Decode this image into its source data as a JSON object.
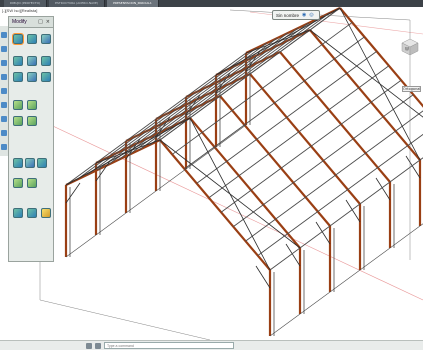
{
  "tabs": [
    "DIBUJO (PROYECTO)",
    "ESTRUCTURA (ACERO-NAVE)",
    "PRESENTACION_PARCIAL1"
  ],
  "active_tab_index": 2,
  "viewport": {
    "label": "[-][SW Iso][Realista]"
  },
  "modify_palette": {
    "title": "Modify",
    "pin": "□",
    "close": "×"
  },
  "snap_bar": {
    "label": "Sin nombre",
    "icon_a": "◉",
    "icon_b": "◎"
  },
  "viewcube": {
    "face_label": "W"
  },
  "wcs_label": "Ortogonal",
  "command_line": {
    "placeholder": "Type a command"
  },
  "colors": {
    "steel": "#4b4b4b",
    "rafter": "#9a3f14",
    "brace": "#2b2b2b"
  }
}
